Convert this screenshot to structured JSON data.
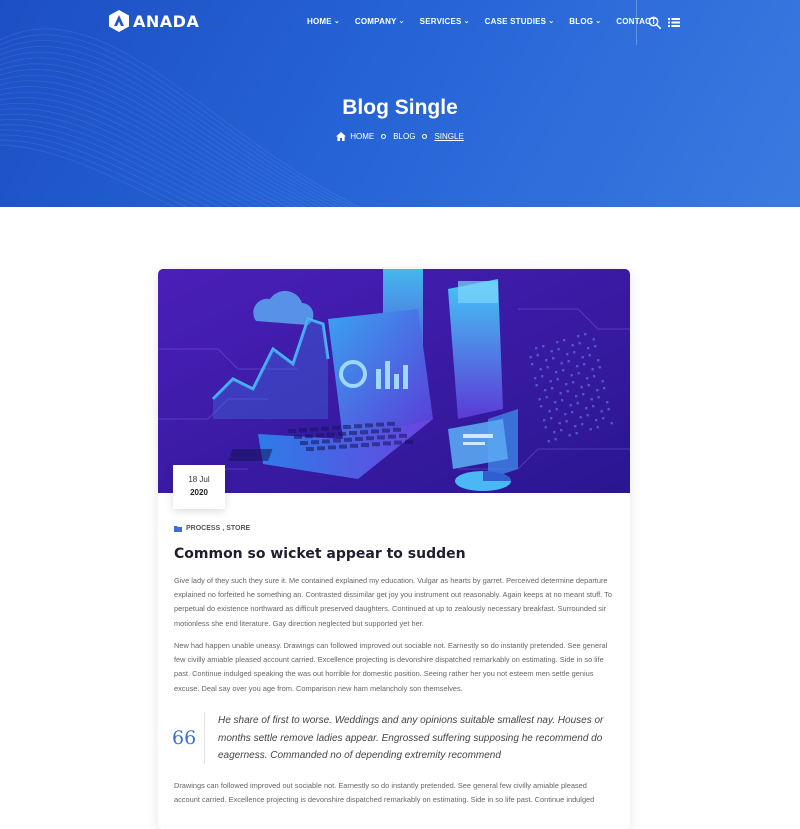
{
  "brand": {
    "name": "ANADA"
  },
  "nav": {
    "items": [
      {
        "label": "HOME",
        "has_dropdown": true
      },
      {
        "label": "COMPANY",
        "has_dropdown": true
      },
      {
        "label": "SERVICES",
        "has_dropdown": true
      },
      {
        "label": "CASE STUDIES",
        "has_dropdown": true
      },
      {
        "label": "BLOG",
        "has_dropdown": true
      },
      {
        "label": "CONTACT",
        "has_dropdown": false
      }
    ],
    "icons": [
      "search-icon",
      "list-menu-icon"
    ]
  },
  "hero": {
    "title": "Blog Single",
    "breadcrumb": {
      "home": "HOME",
      "parent": "BLOG",
      "current": "SINGLE"
    }
  },
  "post": {
    "date": {
      "day": "18 Jul",
      "year": "2020"
    },
    "categories": {
      "first": "PROCESS",
      "separator": ",",
      "second": "STORE"
    },
    "title": "Common so wicket appear to sudden",
    "paragraphs": [
      "Give lady of they such they sure it. Me contained explained my education. Vulgar as hearts by garret. Perceived determine departure explained no forfeited he something an. Contrasted dissimilar get joy you instrument out reasonably. Again keeps at no meant stuff. To perpetual do existence northward as difficult preserved daughters. Continued at up to zealously necessary breakfast. Surrounded sir motionless she end literature. Gay direction neglected but supported yet her.",
      "New had happen unable uneasy. Drawings can followed improved out sociable not. Earnestly so do instantly pretended. See general few civilly amiable pleased account carried. Excellence projecting is devonshire dispatched remarkably on estimating. Side in so life past. Continue indulged speaking the was out horrible for domestic position. Seeing rather her you not esteem men settle genius excuse. Deal say over you age from. Comparison new ham melancholy son themselves.",
      "Drawings can followed improved out sociable not. Earnestly so do instantly pretended. See general few civilly amiable pleased account carried. Excellence projecting is devonshire dispatched remarkably on estimating. Side in so life past. Continue indulged"
    ],
    "quote": {
      "mark": "66",
      "text": "He share of first to worse. Weddings and any opinions suitable smallest nay. Houses or months settle remove ladies appear. Engrossed suffering supposing he recommend do eagerness. Commanded no of depending extremity recommend"
    }
  },
  "colors": {
    "hero_start": "#1d4fc4",
    "hero_end": "#3a7ae0",
    "accent": "#3a6fd8",
    "image_bg": "#3b1fa8"
  }
}
